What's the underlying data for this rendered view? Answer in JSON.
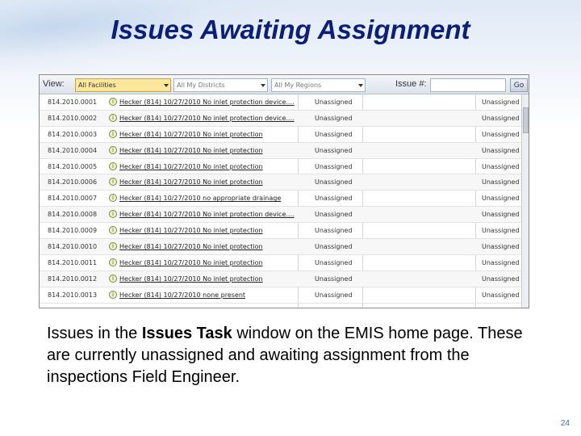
{
  "slide": {
    "title": "Issues Awaiting Assignment",
    "caption_part1": "Issues in the ",
    "caption_bold": "Issues Task",
    "caption_part2": " window on the EMIS home page. These are currently unassigned and awaiting assignment from the inspections Field Engineer.",
    "page_number": "24"
  },
  "toolbar": {
    "view_label": "View:",
    "facilities": "All Facilities",
    "districts": "All My Districts",
    "regions": "All My Regions",
    "issue_label": "Issue #:",
    "issue_value": "",
    "go_label": "Go"
  },
  "rows": [
    {
      "id": "814.2010.0001",
      "desc": "Hecker (814) 10/27/2010 No inlet protection device....",
      "status": "Unassigned",
      "status2": "Unassigned"
    },
    {
      "id": "814.2010.0002",
      "desc": "Hecker (814) 10/27/2010 No inlet protection device....",
      "status": "Unassigned",
      "status2": "Unassigned"
    },
    {
      "id": "814.2010.0003",
      "desc": "Hecker (814) 10/27/2010 No inlet protection",
      "status": "Unassigned",
      "status2": "Unassigned"
    },
    {
      "id": "814.2010.0004",
      "desc": "Hecker (814) 10/27/2010 No inlet protection",
      "status": "Unassigned",
      "status2": "Unassigned"
    },
    {
      "id": "814.2010.0005",
      "desc": "Hecker (814) 10/27/2010 No inlet protection",
      "status": "Unassigned",
      "status2": "Unassigned"
    },
    {
      "id": "814.2010.0006",
      "desc": "Hecker (814) 10/27/2010 No inlet protection",
      "status": "Unassigned",
      "status2": "Unassigned"
    },
    {
      "id": "814.2010.0007",
      "desc": "Hecker (814) 10/27/2010 no appropriate drainage",
      "status": "Unassigned",
      "status2": "Unassigned"
    },
    {
      "id": "814.2010.0008",
      "desc": "Hecker (814) 10/27/2010 No inlet protection device....",
      "status": "Unassigned",
      "status2": "Unassigned"
    },
    {
      "id": "814.2010.0009",
      "desc": "Hecker (814) 10/27/2010 No inlet protection",
      "status": "Unassigned",
      "status2": "Unassigned"
    },
    {
      "id": "814.2010.0010",
      "desc": "Hecker (814) 10/27/2010 No inlet protection",
      "status": "Unassigned",
      "status2": "Unassigned"
    },
    {
      "id": "814.2010.0011",
      "desc": "Hecker (814) 10/27/2010 No inlet protection",
      "status": "Unassigned",
      "status2": "Unassigned"
    },
    {
      "id": "814.2010.0012",
      "desc": "Hecker (814) 10/27/2010 No inlet protection",
      "status": "Unassigned",
      "status2": "Unassigned"
    },
    {
      "id": "814.2010.0013",
      "desc": "Hecker (814) 10/27/2010 none present",
      "status": "Unassigned",
      "status2": "Unassigned"
    }
  ]
}
